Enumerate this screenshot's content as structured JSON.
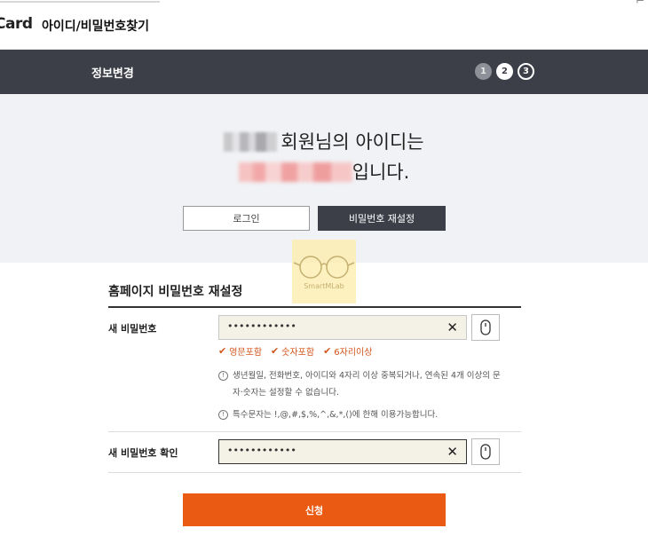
{
  "header": {
    "brand": "Card",
    "find_title": "아이디/비밀번호찾기",
    "close": "⌐"
  },
  "stepbar": {
    "title": "정보변경",
    "steps": [
      "1",
      "2",
      "3"
    ],
    "active_step": 2
  },
  "result": {
    "line1_suffix": "회원님의 아이디는",
    "line2_suffix": "입니다.",
    "login_button": "로그인",
    "reset_button": "비밀번호 재설정"
  },
  "watermark": {
    "text": "SmartMLab"
  },
  "reset_form": {
    "title": "홈페이지 비밀번호 재설정",
    "new_password": {
      "label": "새 비밀번호",
      "value": "••••••••••••",
      "clear": "✕"
    },
    "checks": [
      {
        "tick": "✔",
        "label": "영문포함"
      },
      {
        "tick": "✔",
        "label": "숫자포함"
      },
      {
        "tick": "✔",
        "label": "6자리이상"
      }
    ],
    "notes": [
      {
        "icon": "!",
        "text": "생년월일, 전화번호, 아이디와 4자리 이상 중복되거나, 연속된 4개 이상의 문자·숫자는 설정할 수 없습니다."
      },
      {
        "icon": "!",
        "text": "특수문자는 !,@,#,$,%,^,&,*,()에 한해 이용가능합니다."
      }
    ],
    "confirm_password": {
      "label": "새 비밀번호 확인",
      "value": "••••••••••••",
      "clear": "✕"
    },
    "submit_label": "신청"
  },
  "colors": {
    "dark_bar": "#3c3f48",
    "result_bg": "#f1f2f5",
    "accent": "#ea5a12",
    "check_color": "#d4561c"
  }
}
